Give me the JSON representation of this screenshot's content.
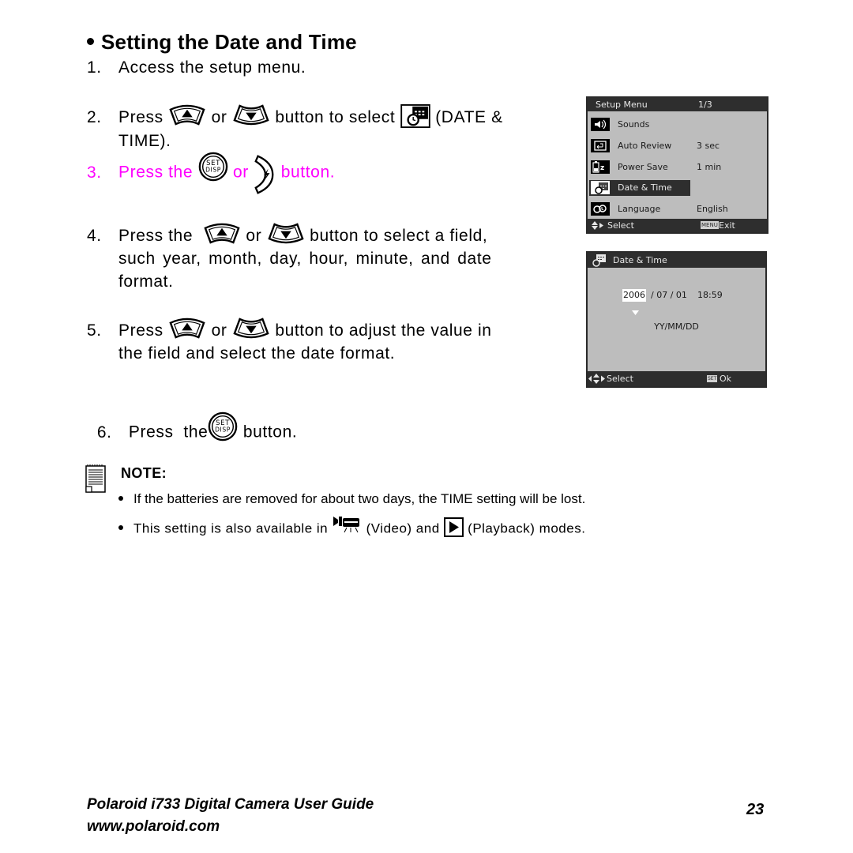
{
  "page": {
    "title": "Setting the Date and Time",
    "steps": [
      {
        "num": "1.",
        "text": "Access the setup menu."
      },
      {
        "num": "2.",
        "pre": "Press",
        "mid": "or",
        "post": "button to select",
        "tail": "(DATE &",
        "cont": "TIME)."
      },
      {
        "num": "3.",
        "pre": "Press the",
        "mid": "or",
        "post": "button."
      },
      {
        "num": "4.",
        "pre": "Press the",
        "mid": "or",
        "post": "button to select a field,",
        "cont1": "such year, month, day, hour, minute, and date",
        "cont2": "format."
      },
      {
        "num": "5.",
        "pre": "Press",
        "mid": "or",
        "post": "button to adjust the value in",
        "cont": "the field and select the date format."
      },
      {
        "num": "6.",
        "pre": "Press  the",
        "post": "button."
      }
    ],
    "highlight_color": "#ff00ff",
    "icons": {
      "up": "up-arrow-button-icon",
      "down": "down-arrow-button-icon",
      "set_disp": "set-disp-button-icon",
      "flash": "flash-right-button-icon",
      "date_time": "date-time-icon",
      "video": "video-mode-icon",
      "playback": "playback-mode-icon",
      "note": "notepad-icon"
    },
    "set_label": "SET",
    "disp_label": "DISP"
  },
  "setup_menu": {
    "header": "Setup Menu",
    "page": "1/3",
    "items": [
      {
        "label": "Sounds",
        "value": "",
        "icon": "sound-icon"
      },
      {
        "label": "Auto Review",
        "value": "3 sec",
        "icon": "auto-review-icon"
      },
      {
        "label": "Power Save",
        "value": "1 min",
        "icon": "power-save-icon"
      },
      {
        "label": "Date & Time",
        "value": "",
        "icon": "date-time-icon",
        "selected": true
      },
      {
        "label": "Language",
        "value": "English",
        "icon": "language-icon"
      }
    ],
    "footer_select": "Select",
    "footer_menu_key": "MENU",
    "footer_exit": "Exit"
  },
  "date_screen": {
    "header": "Date & Time",
    "year": "2006",
    "rest": "/ 07 / 01",
    "time": "18:59",
    "format": "YY/MM/DD",
    "footer_select": "Select",
    "footer_set_key": "SET",
    "footer_ok": "Ok"
  },
  "note": {
    "title": "NOTE:",
    "items": [
      {
        "text": "If the batteries are removed for about two days, the TIME setting will be lost."
      },
      {
        "pre": "This setting is also available in",
        "video": "(Video) and",
        "playback": "(Playback) modes."
      }
    ]
  },
  "footer": {
    "guide_title": "Polaroid i733 Digital Camera User Guide",
    "url": "www.polaroid.com",
    "page_number": "23"
  }
}
